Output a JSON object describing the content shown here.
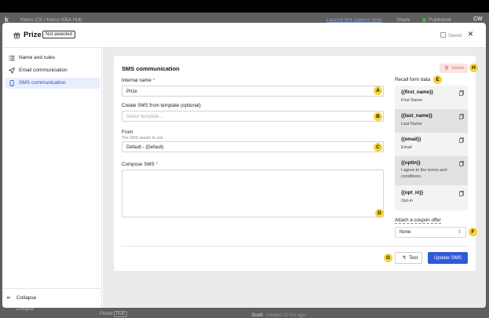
{
  "background": {
    "logo": "k",
    "breadcrumb": "Kemo CS  /  Kemo KBA Hub",
    "link_text": "Launch link (opens new)",
    "share": "Share",
    "status": "Published",
    "user": "CW",
    "bottom_collapse": "Collapse",
    "picker": "Picker",
    "picker_badge": "Draft",
    "draft": "Draft",
    "draft_time": "created 10 hrs ago"
  },
  "header": {
    "icon": "gift-icon",
    "title": "Prize",
    "badge": "Not awarded",
    "saved": "Saved",
    "close": "×"
  },
  "sidebar": {
    "items": [
      {
        "label": "Name and rules",
        "icon": "list-icon"
      },
      {
        "label": "Email communication",
        "icon": "send-icon"
      },
      {
        "label": "SMS communication",
        "icon": "phone-icon"
      }
    ],
    "collapse": "Collapse"
  },
  "form": {
    "title": "SMS communication",
    "delete": "Delete",
    "internal_name_label": "Internal name",
    "required": "*",
    "internal_name_value": "Prize",
    "template_label": "Create SMS from template (optional)",
    "template_placeholder": "Select template...",
    "from_label": "From",
    "from_hint": "The SMS sender to use",
    "from_value": "Default - (Default)",
    "compose_label": "Compose SMS",
    "compose_value": "",
    "recall_title": "Recall form data",
    "recall_items": [
      {
        "token": "{{first_name}}",
        "desc": "First Name"
      },
      {
        "token": "{{last_name}}",
        "desc": "Last Name"
      },
      {
        "token": "{{email}}",
        "desc": "Email"
      },
      {
        "token": "{{optin}}",
        "desc": "I agree to the terms and conditions."
      },
      {
        "token": "{{opt_in}}",
        "desc": "Opt-in"
      }
    ],
    "coupon_label": "Attach a coupon offer",
    "coupon_value": "None",
    "test_button": "Test",
    "update_button": "Update SMS"
  },
  "markers": {
    "a": "A",
    "b": "B",
    "c": "C",
    "d": "D",
    "e": "E",
    "f": "F",
    "g": "G",
    "h": "H"
  },
  "colors": {
    "accent": "#2f5ad9",
    "marker": "#f5d33a",
    "active_nav_bg": "#e8eefc",
    "delete_bg": "#fbe3e3"
  }
}
